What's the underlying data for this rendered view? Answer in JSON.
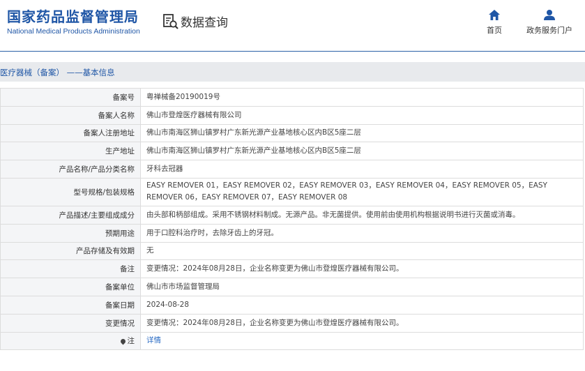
{
  "header": {
    "logo_cn": "国家药品监督管理局",
    "logo_en": "National Medical Products Administration",
    "query_label": "数据查询",
    "nav_home": "首页",
    "nav_portal": "政务服务门户",
    "brand_color": "#1f56a6"
  },
  "breadcrumb": "医疗器械（备案） ——基本信息",
  "rows": [
    {
      "label": "备案号",
      "value": "粤禅械备20190019号"
    },
    {
      "label": "备案人名称",
      "value": "佛山市登煌医疗器械有限公司"
    },
    {
      "label": "备案人注册地址",
      "value": "佛山市南海区狮山镇罗村广东新光源产业基地核心区内B区5座二层"
    },
    {
      "label": "生产地址",
      "value": "佛山市南海区狮山镇罗村广东新光源产业基地核心区内B区5座二层"
    },
    {
      "label": "产品名称/产品分类名称",
      "value": "牙科去冠器"
    },
    {
      "label": "型号规格/包装规格",
      "value": "EASY REMOVER 01，EASY REMOVER 02，EASY REMOVER 03，EASY REMOVER 04，EASY REMOVER 05，EASY REMOVER 06，EASY REMOVER 07，EASY REMOVER 08"
    },
    {
      "label": "产品描述/主要组成成分",
      "value": "由头部和柄部组成。采用不锈钢材料制成。无源产品。非无菌提供。使用前由使用机构根据说明书进行灭菌或消毒。"
    },
    {
      "label": "预期用途",
      "value": "用于口腔科治疗时，去除牙齿上的牙冠。"
    },
    {
      "label": "产品存储及有效期",
      "value": "无"
    },
    {
      "label": "备注",
      "value": "变更情况：2024年08月28日，企业名称变更为佛山市登煌医疗器械有限公司。"
    },
    {
      "label": "备案单位",
      "value": "佛山市市场监督管理局"
    },
    {
      "label": "备案日期",
      "value": "2024-08-28"
    },
    {
      "label": "变更情况",
      "value": "变更情况：2024年08月28日，企业名称变更为佛山市登煌医疗器械有限公司。"
    },
    {
      "label": "注",
      "value": "详情"
    }
  ]
}
